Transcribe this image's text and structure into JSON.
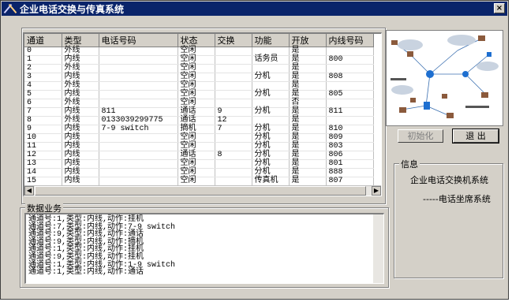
{
  "window": {
    "title": "企业电话交换与传真系统",
    "close_label": "×"
  },
  "table": {
    "columns": [
      "通道",
      "类型",
      "电话号码",
      "状态",
      "交换",
      "功能",
      "开放",
      "内线号码"
    ],
    "rows": [
      [
        "0",
        "外线",
        "",
        "空闲",
        "",
        "",
        "是",
        ""
      ],
      [
        "1",
        "内线",
        "",
        "空闲",
        "",
        "话务员",
        "是",
        "800"
      ],
      [
        "2",
        "外线",
        "",
        "空闲",
        "",
        "",
        "是",
        ""
      ],
      [
        "3",
        "内线",
        "",
        "空闲",
        "",
        "分机",
        "是",
        "808"
      ],
      [
        "4",
        "外线",
        "",
        "空闲",
        "",
        "",
        "是",
        ""
      ],
      [
        "5",
        "内线",
        "",
        "空闲",
        "",
        "分机",
        "是",
        "805"
      ],
      [
        "6",
        "外线",
        "",
        "空闲",
        "",
        "",
        "否",
        ""
      ],
      [
        "7",
        "内线",
        "811",
        "通话",
        "9",
        "分机",
        "是",
        "811"
      ],
      [
        "8",
        "外线",
        "0133039299775",
        "通话",
        "12",
        "",
        "是",
        ""
      ],
      [
        "9",
        "内线",
        "7-9 switch",
        "摘机",
        "7",
        "分机",
        "是",
        "810"
      ],
      [
        "10",
        "内线",
        "",
        "空闲",
        "",
        "分机",
        "是",
        "809"
      ],
      [
        "11",
        "内线",
        "",
        "空闲",
        "",
        "分机",
        "是",
        "803"
      ],
      [
        "12",
        "内线",
        "",
        "通话",
        "8",
        "分机",
        "是",
        "806"
      ],
      [
        "13",
        "内线",
        "",
        "空闲",
        "",
        "分机",
        "是",
        "801"
      ],
      [
        "14",
        "内线",
        "",
        "空闲",
        "",
        "分机",
        "是",
        "888"
      ],
      [
        "15",
        "内线",
        "",
        "空闲",
        "",
        "传真机",
        "是",
        "807"
      ]
    ]
  },
  "buttons": {
    "init_label": "初始化",
    "exit_label": "退 出"
  },
  "log": {
    "group_label": "数据业务",
    "lines": [
      "通道号:1,类型:内线,动作:挂机",
      "通道号:7,类型:内线,动作:7-9 switch",
      "通道号:9,类型:内线,动作:通话",
      "通道号:9,类型:内线,动作:摘机",
      "通道号:1,类型:内线,动作:挂机",
      "通道号:9,类型:内线,动作:挂机",
      "通道号:1,类型:内线,动作:1-9 switch",
      "通道号:1,类型:内线,动作:通话"
    ]
  },
  "info": {
    "group_label": "信息",
    "line1": "企业电话交换机系统",
    "line2": "-----电话坐席系统"
  }
}
